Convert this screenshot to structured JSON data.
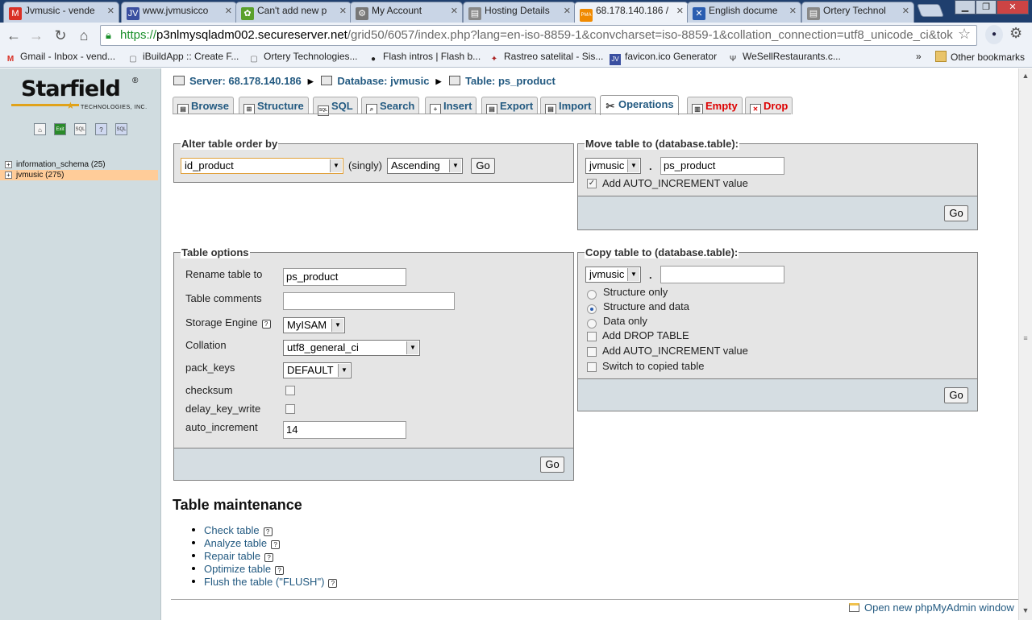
{
  "browser": {
    "tabs": [
      {
        "title": "Jvmusic - vende",
        "icon": "gmail-icon",
        "fav_text": "M",
        "fav_color": "#d93025"
      },
      {
        "title": "www.jvmusicco",
        "icon": "jv-icon",
        "fav_text": "JV",
        "fav_color": "#3a4fa0"
      },
      {
        "title": "Can't add new p",
        "icon": "leaf-icon",
        "fav_text": "✿",
        "fav_color": "#5aa02c"
      },
      {
        "title": "My Account",
        "icon": "gear-icon",
        "fav_text": "⚙",
        "fav_color": "#777777"
      },
      {
        "title": "Hosting Details",
        "icon": "page-icon",
        "fav_text": "▤",
        "fav_color": "#888888"
      },
      {
        "title": "68.178.140.186 /",
        "icon": "pma-icon",
        "fav_text": "PMA",
        "fav_color": "#f08a00"
      },
      {
        "title": "English docume",
        "icon": "tools-icon",
        "fav_text": "✕",
        "fav_color": "#2a5db0"
      },
      {
        "title": "Ortery Technol",
        "icon": "page-icon",
        "fav_text": "▤",
        "fav_color": "#888888"
      }
    ],
    "url": {
      "scheme": "https://",
      "host": "p3nlmysqladm002.secureserver.net",
      "path": "/grid50/6057/index.php?lang=en-iso-8859-1&convcharset=iso-8859-1&collation_connection=utf8_unicode_ci&tok"
    },
    "bookmarks": [
      {
        "label": "Gmail - Inbox - vend...",
        "icon": "gmail-icon",
        "glyph": "M",
        "color": "#d93025"
      },
      {
        "label": "iBuildApp :: Create F...",
        "icon": "page-icon",
        "glyph": "▢",
        "color": "#666666"
      },
      {
        "label": "Ortery Technologies...",
        "icon": "page-icon",
        "glyph": "▢",
        "color": "#666666"
      },
      {
        "label": "Flash intros | Flash b...",
        "icon": "flash-icon",
        "glyph": "●",
        "color": "#222222"
      },
      {
        "label": "Rastreo satelital - Sis...",
        "icon": "satellite-icon",
        "glyph": "✦",
        "color": "#aa2222"
      },
      {
        "label": "favicon.ico Generator",
        "icon": "jv-icon",
        "glyph": "JV",
        "color": "#3a4fa0"
      },
      {
        "label": "WeSellRestaurants.c...",
        "icon": "fork-icon",
        "glyph": "Ψ",
        "color": "#333333"
      }
    ],
    "bookmarks_more": "»",
    "other_bookmarks": "Other bookmarks"
  },
  "leftframe": {
    "logo_text": "Starfield",
    "logo_sub": "TECHNOLOGIES, INC.",
    "icons": [
      {
        "name": "home-icon",
        "glyph": "⌂"
      },
      {
        "name": "exit-icon",
        "glyph": "Exit"
      },
      {
        "name": "sql-icon",
        "glyph": "SQL"
      },
      {
        "name": "docs-icon",
        "glyph": "?"
      },
      {
        "name": "sql-docs-icon",
        "glyph": "SQL"
      }
    ],
    "databases": [
      {
        "label": "information_schema (25)"
      },
      {
        "label": "jvmusic (275)"
      }
    ]
  },
  "breadcrumb": {
    "server": "Server: 68.178.140.186",
    "database": "Database: jvmusic",
    "table": "Table: ps_product"
  },
  "tabs": [
    {
      "label": "Browse",
      "icon": "browse-icon",
      "glyph": "▤"
    },
    {
      "label": "Structure",
      "icon": "structure-icon",
      "glyph": "⊞"
    },
    {
      "label": "SQL",
      "icon": "sql-icon",
      "glyph": "SQL"
    },
    {
      "label": "Search",
      "icon": "search-icon",
      "glyph": "⌕"
    },
    {
      "label": "Insert",
      "icon": "insert-icon",
      "glyph": "+"
    },
    {
      "label": "Export",
      "icon": "export-icon",
      "glyph": "▤"
    },
    {
      "label": "Import",
      "icon": "import-icon",
      "glyph": "▤"
    },
    {
      "label": "Operations",
      "icon": "operations-icon",
      "glyph": "✂"
    },
    {
      "label": "Empty",
      "icon": "empty-icon",
      "glyph": "▥"
    },
    {
      "label": "Drop",
      "icon": "drop-icon",
      "glyph": "✕"
    }
  ],
  "alter_order": {
    "legend": "Alter table order by",
    "column": "id_product",
    "singly": "(singly)",
    "direction": "Ascending",
    "go": "Go"
  },
  "move_table": {
    "legend": "Move table to (database.table):",
    "db": "jvmusic",
    "dot": ".",
    "table": "ps_product",
    "auto_increment_label": "Add AUTO_INCREMENT value",
    "auto_increment_checked": true,
    "go": "Go"
  },
  "table_options": {
    "legend": "Table options",
    "rename_label": "Rename table to",
    "rename_value": "ps_product",
    "comments_label": "Table comments",
    "comments_value": "",
    "engine_label": "Storage Engine",
    "engine_value": "MyISAM",
    "collation_label": "Collation",
    "collation_value": "utf8_general_ci",
    "pack_keys_label": "pack_keys",
    "pack_keys_value": "DEFAULT",
    "checksum_label": "checksum",
    "delay_key_write_label": "delay_key_write",
    "auto_increment_label": "auto_increment",
    "auto_increment_value": "14",
    "go": "Go"
  },
  "copy_table": {
    "legend": "Copy table to (database.table):",
    "db": "jvmusic",
    "dot": ".",
    "table": "",
    "radios": [
      {
        "label": "Structure only",
        "checked": false
      },
      {
        "label": "Structure and data",
        "checked": true
      },
      {
        "label": "Data only",
        "checked": false
      }
    ],
    "checkboxes": [
      {
        "label": "Add DROP TABLE",
        "checked": false
      },
      {
        "label": "Add AUTO_INCREMENT value",
        "checked": false
      },
      {
        "label": "Switch to copied table",
        "checked": false
      }
    ],
    "go": "Go"
  },
  "maintenance": {
    "title": "Table maintenance",
    "items": [
      {
        "label": "Check table"
      },
      {
        "label": "Analyze table"
      },
      {
        "label": "Repair table"
      },
      {
        "label": "Optimize table"
      },
      {
        "label": "Flush the table (\"FLUSH\")"
      }
    ]
  },
  "new_window_link": "Open new phpMyAdmin window"
}
